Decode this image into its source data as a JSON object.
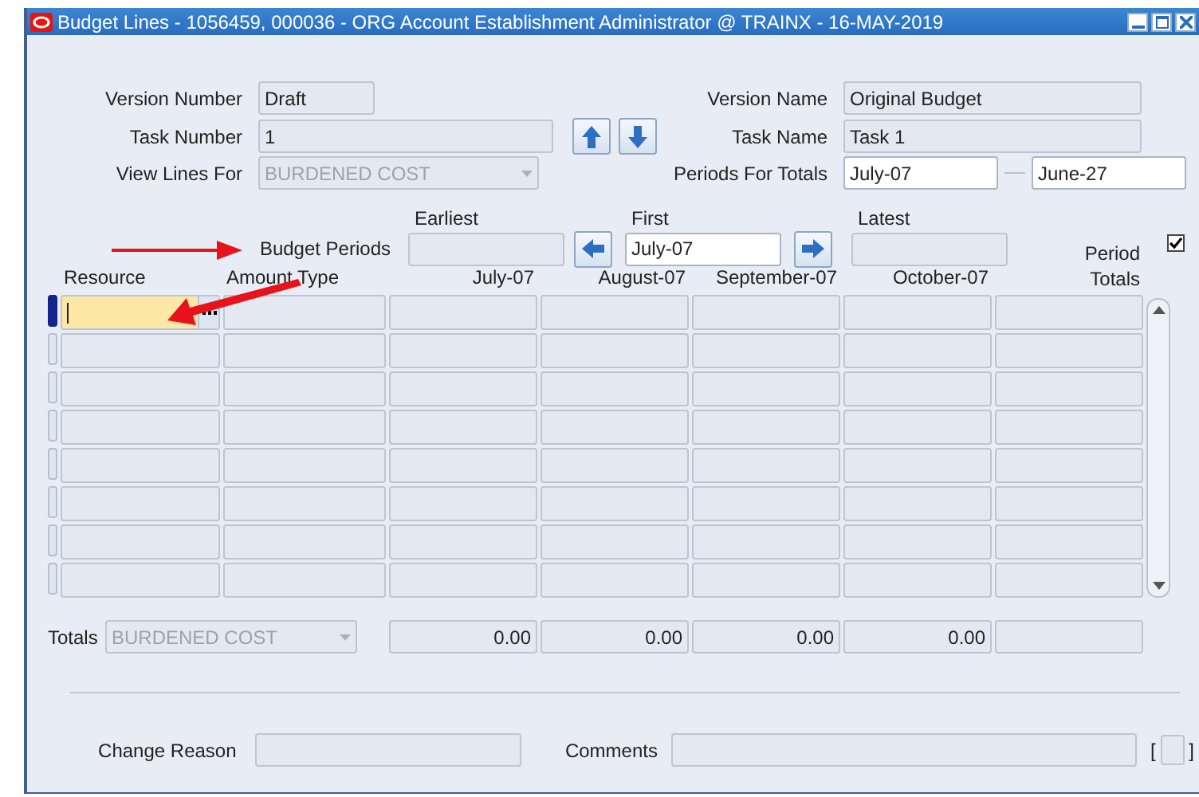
{
  "window": {
    "title": "Budget Lines - 1056459, 000036 - ORG Account Establishment Administrator @ TRAINX - 16-MAY-2019"
  },
  "header": {
    "version_number": {
      "label": "Version Number",
      "value": "Draft"
    },
    "task_number": {
      "label": "Task Number",
      "value": "1"
    },
    "view_lines_for": {
      "label": "View Lines For",
      "value": "BURDENED COST",
      "disabled": true
    },
    "version_name": {
      "label": "Version Name",
      "value": "Original Budget"
    },
    "task_name": {
      "label": "Task Name",
      "value": "Task 1"
    },
    "periods_for_totals": {
      "label": "Periods For Totals",
      "from": "July-07",
      "to": "June-27"
    }
  },
  "budget_periods": {
    "label": "Budget Periods",
    "earliest": {
      "label": "Earliest"
    },
    "first": {
      "label": "First",
      "value": "July-07"
    },
    "latest": {
      "label": "Latest"
    },
    "show_period_totals": {
      "checked": true
    }
  },
  "table": {
    "columns": [
      "Resource",
      "Amount Type",
      "July-07",
      "August-07",
      "September-07",
      "October-07",
      "Period Totals"
    ],
    "rows": [
      {
        "selected": true
      },
      {
        "selected": false
      },
      {
        "selected": false
      },
      {
        "selected": false
      },
      {
        "selected": false
      },
      {
        "selected": false
      },
      {
        "selected": false
      },
      {
        "selected": false
      }
    ]
  },
  "totals": {
    "label": "Totals",
    "amount_type": {
      "value": "BURDENED COST",
      "disabled": true
    },
    "values": [
      "0.00",
      "0.00",
      "0.00",
      "0.00"
    ]
  },
  "footer": {
    "change_reason": {
      "label": "Change Reason"
    },
    "comments": {
      "label": "Comments"
    },
    "bracket_open": "[",
    "bracket_close": "]"
  }
}
